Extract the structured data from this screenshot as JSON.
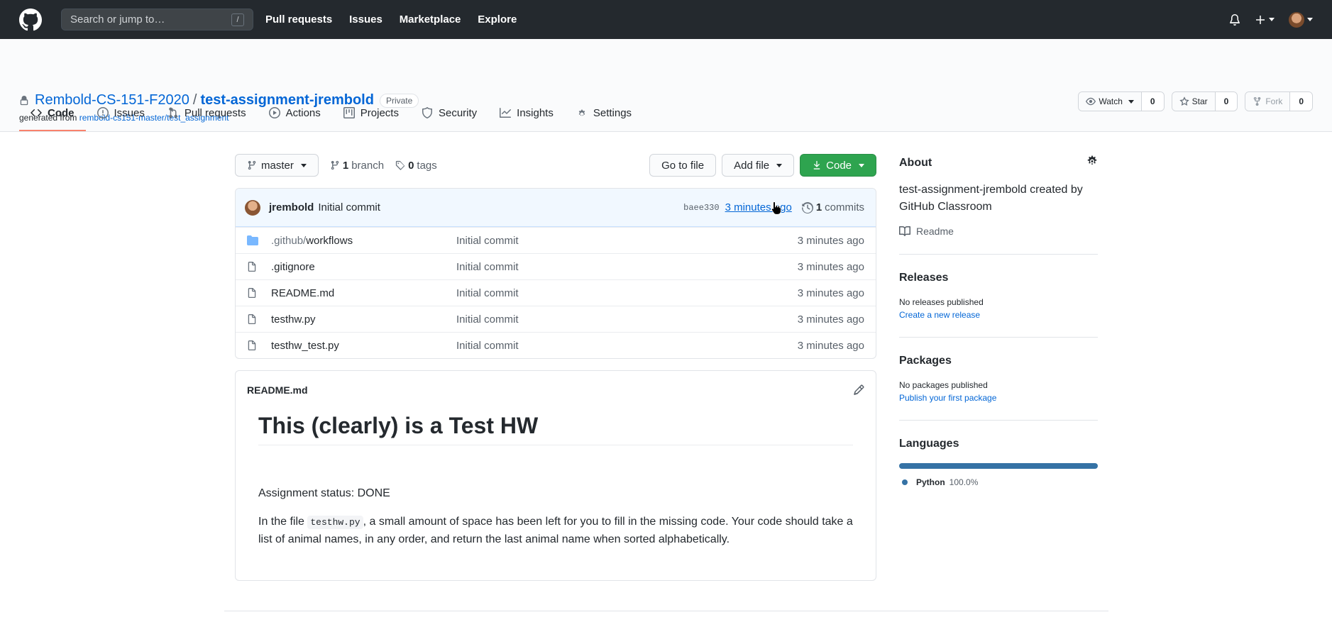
{
  "header": {
    "search_placeholder": "Search or jump to…",
    "search_key": "/",
    "nav": [
      "Pull requests",
      "Issues",
      "Marketplace",
      "Explore"
    ]
  },
  "repo": {
    "owner": "Rembold-CS-151-F2020",
    "separator": "/",
    "name": "test-assignment-jrembold",
    "visibility": "Private",
    "generated_prefix": "generated from",
    "generated_link": "rembold-cs151-master/test_assignment",
    "watch_label": "Watch",
    "watch_count": "0",
    "star_label": "Star",
    "star_count": "0",
    "fork_label": "Fork",
    "fork_count": "0"
  },
  "tabs": [
    {
      "label": "Code",
      "icon": "code-icon"
    },
    {
      "label": "Issues",
      "icon": "issue-icon"
    },
    {
      "label": "Pull requests",
      "icon": "pull-request-icon"
    },
    {
      "label": "Actions",
      "icon": "play-icon"
    },
    {
      "label": "Projects",
      "icon": "project-icon"
    },
    {
      "label": "Security",
      "icon": "shield-icon"
    },
    {
      "label": "Insights",
      "icon": "graph-icon"
    },
    {
      "label": "Settings",
      "icon": "gear-icon"
    }
  ],
  "toolbar": {
    "branch": "master",
    "branch_count": "1",
    "branch_label": "branch",
    "tag_count": "0",
    "tag_label": "tags",
    "go_to_file": "Go to file",
    "add_file": "Add file",
    "code": "Code"
  },
  "commit": {
    "author": "jrembold",
    "message": "Initial commit",
    "sha": "baee330",
    "time": "3 minutes ago",
    "commit_count": "1",
    "commit_label": "commits"
  },
  "files": [
    {
      "type": "folder",
      "prefix": ".github/",
      "name": "workflows",
      "commit": "Initial commit",
      "age": "3 minutes ago"
    },
    {
      "type": "file",
      "prefix": "",
      "name": ".gitignore",
      "commit": "Initial commit",
      "age": "3 minutes ago"
    },
    {
      "type": "file",
      "prefix": "",
      "name": "README.md",
      "commit": "Initial commit",
      "age": "3 minutes ago"
    },
    {
      "type": "file",
      "prefix": "",
      "name": "testhw.py",
      "commit": "Initial commit",
      "age": "3 minutes ago"
    },
    {
      "type": "file",
      "prefix": "",
      "name": "testhw_test.py",
      "commit": "Initial commit",
      "age": "3 minutes ago"
    }
  ],
  "readme": {
    "filename": "README.md",
    "heading": "This (clearly) is a Test HW",
    "status": "Assignment status: DONE",
    "para_before": "In the file ",
    "para_code": "testhw.py",
    "para_after": ", a small amount of space has been left for you to fill in the missing code. Your code should take a list of animal names, in any order, and return the last animal name when sorted alphabetically."
  },
  "sidebar": {
    "about_title": "About",
    "about_desc": "test-assignment-jrembold created by GitHub Classroom",
    "readme_label": "Readme",
    "releases_title": "Releases",
    "releases_text": "No releases published",
    "releases_link": "Create a new release",
    "packages_title": "Packages",
    "packages_text": "No packages published",
    "packages_link": "Publish your first package",
    "languages_title": "Languages",
    "language_name": "Python",
    "language_pct": "100.0%",
    "language_color": "#3572A5"
  }
}
